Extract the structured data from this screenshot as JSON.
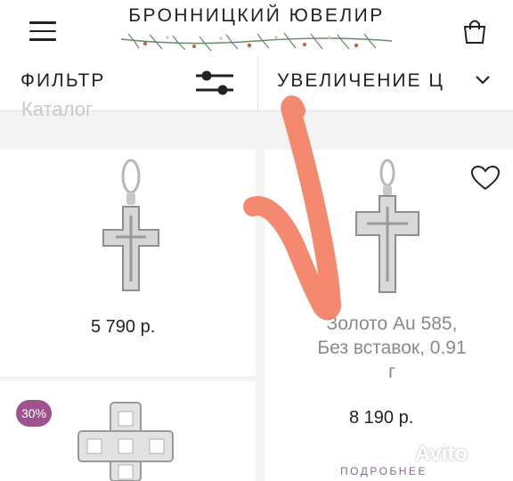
{
  "header": {
    "logo_text": "БРОННИЦКИЙ ЮВЕЛИР",
    "menu_icon": "hamburger-icon",
    "cart_icon": "shopping-bag-icon"
  },
  "toolbar": {
    "filter_label": "ФИЛЬТР",
    "filter_icon": "sliders-icon",
    "sort_label": "УВЕЛИЧЕНИЕ Ц",
    "sort_icon": "chevron-down-icon"
  },
  "catalog_label": "Каталог",
  "products": [
    {
      "price": "5 790 р."
    },
    {
      "description_line1": "Золото Au 585,",
      "description_line2": "Без вставок, 0.91",
      "description_line3": "г",
      "price": "8 190 р.",
      "more_label": "ПОДРОБНЕЕ",
      "favorite_icon": "heart-icon"
    },
    {
      "discount_badge": "30%"
    }
  ],
  "watermark": "Avito",
  "colors": {
    "badge": "#a0528f",
    "more_link": "#8a6a8f",
    "annotation_mark": "#f47c5f"
  }
}
